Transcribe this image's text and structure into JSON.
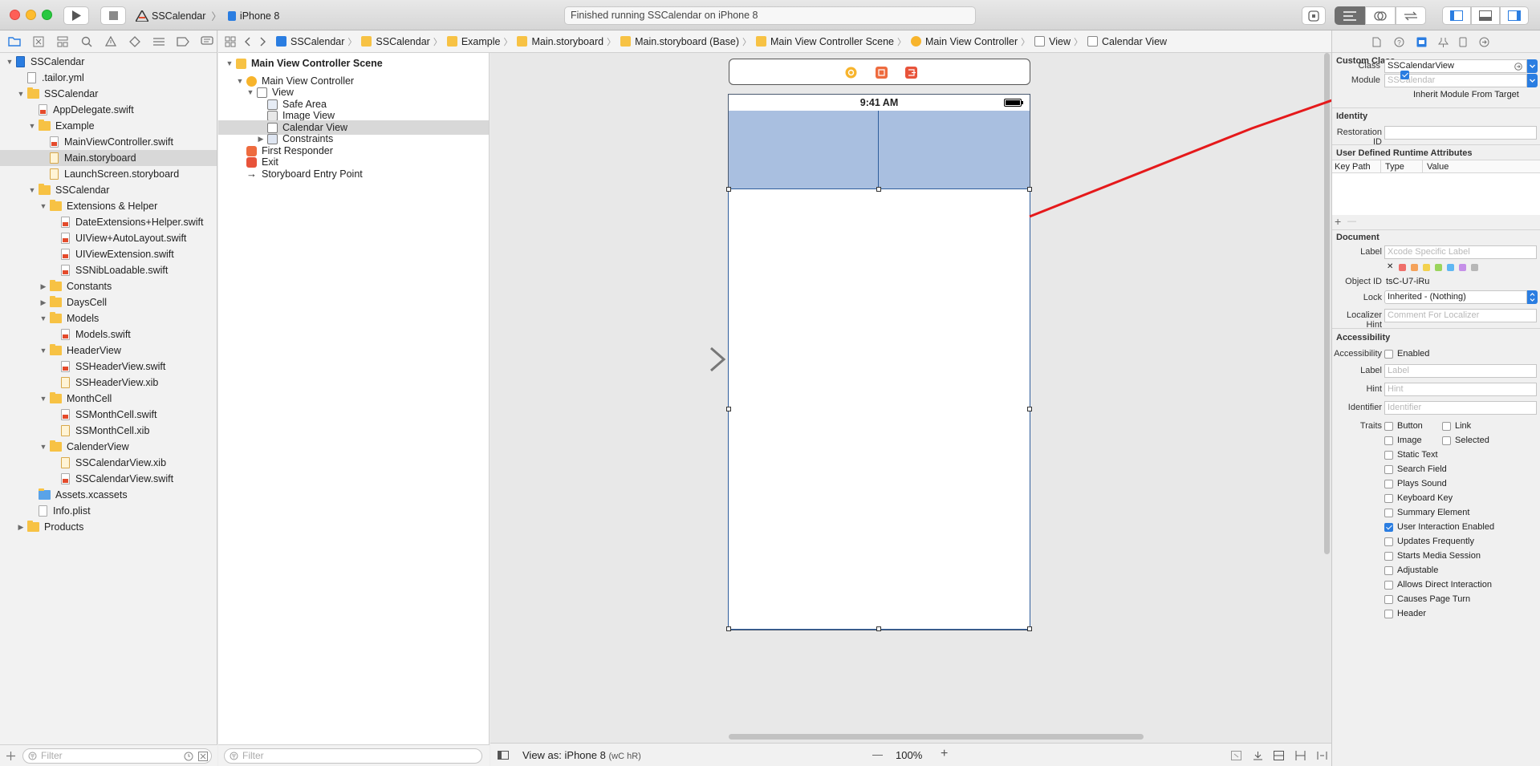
{
  "toolbar": {
    "scheme_name": "SSCalendar",
    "device_name": "iPhone 8",
    "activity_status": "Finished running SSCalendar on iPhone 8"
  },
  "navigator": {
    "items": [
      {
        "label": "SSCalendar",
        "indent": 0,
        "kind": "project",
        "open": true
      },
      {
        "label": ".tailor.yml",
        "indent": 1,
        "kind": "yml"
      },
      {
        "label": "SSCalendar",
        "indent": 1,
        "kind": "folder",
        "open": true
      },
      {
        "label": "AppDelegate.swift",
        "indent": 2,
        "kind": "swift"
      },
      {
        "label": "Example",
        "indent": 2,
        "kind": "folder",
        "open": true
      },
      {
        "label": "MainViewController.swift",
        "indent": 3,
        "kind": "swift"
      },
      {
        "label": "Main.storyboard",
        "indent": 3,
        "kind": "sb",
        "selected": true
      },
      {
        "label": "LaunchScreen.storyboard",
        "indent": 3,
        "kind": "sb"
      },
      {
        "label": "SSCalendar",
        "indent": 2,
        "kind": "folder",
        "open": true
      },
      {
        "label": "Extensions & Helper",
        "indent": 3,
        "kind": "folder",
        "open": true
      },
      {
        "label": "DateExtensions+Helper.swift",
        "indent": 4,
        "kind": "swift"
      },
      {
        "label": "UIView+AutoLayout.swift",
        "indent": 4,
        "kind": "swift"
      },
      {
        "label": "UIViewExtension.swift",
        "indent": 4,
        "kind": "swift"
      },
      {
        "label": "SSNibLoadable.swift",
        "indent": 4,
        "kind": "swift"
      },
      {
        "label": "Constants",
        "indent": 3,
        "kind": "folder",
        "open": false
      },
      {
        "label": "DaysCell",
        "indent": 3,
        "kind": "folder",
        "open": false
      },
      {
        "label": "Models",
        "indent": 3,
        "kind": "folder",
        "open": true
      },
      {
        "label": "Models.swift",
        "indent": 4,
        "kind": "swift"
      },
      {
        "label": "HeaderView",
        "indent": 3,
        "kind": "folder",
        "open": true
      },
      {
        "label": "SSHeaderView.swift",
        "indent": 4,
        "kind": "swift"
      },
      {
        "label": "SSHeaderView.xib",
        "indent": 4,
        "kind": "xib"
      },
      {
        "label": "MonthCell",
        "indent": 3,
        "kind": "folder",
        "open": true
      },
      {
        "label": "SSMonthCell.swift",
        "indent": 4,
        "kind": "swift"
      },
      {
        "label": "SSMonthCell.xib",
        "indent": 4,
        "kind": "xib"
      },
      {
        "label": "CalenderView",
        "indent": 3,
        "kind": "folder",
        "open": true
      },
      {
        "label": "SSCalendarView.xib",
        "indent": 4,
        "kind": "xib"
      },
      {
        "label": "SSCalendarView.swift",
        "indent": 4,
        "kind": "swift"
      },
      {
        "label": "Assets.xcassets",
        "indent": 2,
        "kind": "assets"
      },
      {
        "label": "Info.plist",
        "indent": 2,
        "kind": "plist"
      },
      {
        "label": "Products",
        "indent": 1,
        "kind": "folder",
        "open": false
      }
    ],
    "filter_placeholder": "Filter"
  },
  "jumpbar": {
    "crumbs": [
      "SSCalendar",
      "SSCalendar",
      "Example",
      "Main.storyboard",
      "Main.storyboard (Base)",
      "Main View Controller Scene",
      "Main View Controller",
      "View",
      "Calendar View"
    ]
  },
  "outline": {
    "scene_title": "Main View Controller Scene",
    "items": [
      {
        "label": "Main View Controller",
        "indent": 1,
        "icon": "vc"
      },
      {
        "label": "View",
        "indent": 2,
        "icon": "view"
      },
      {
        "label": "Safe Area",
        "indent": 3,
        "icon": "safe"
      },
      {
        "label": "Image View",
        "indent": 3,
        "icon": "image"
      },
      {
        "label": "Calendar View",
        "indent": 3,
        "icon": "view",
        "selected": true
      },
      {
        "label": "Constraints",
        "indent": 3,
        "icon": "constraints"
      },
      {
        "label": "First Responder",
        "indent": 1,
        "icon": "responder"
      },
      {
        "label": "Exit",
        "indent": 1,
        "icon": "exit"
      },
      {
        "label": "Storyboard Entry Point",
        "indent": 1,
        "icon": "arrow"
      }
    ],
    "filter_placeholder": "Filter"
  },
  "canvas": {
    "status_time": "9:41 AM",
    "view_as": "View as: iPhone 8",
    "view_as_traits": "(wC hR)",
    "zoom": "100%",
    "zoom_out": "—",
    "zoom_in": "+"
  },
  "inspector": {
    "custom_class": {
      "title": "Custom Class",
      "class_label": "Class",
      "class_value": "SSCalendarView",
      "module_label": "Module",
      "module_placeholder": "SSCalendar",
      "inherit_label": "Inherit Module From Target"
    },
    "identity": {
      "title": "Identity",
      "restoration_label": "Restoration ID"
    },
    "runtime_attributes": {
      "title": "User Defined Runtime Attributes",
      "columns": [
        "Key Path",
        "Type",
        "Value"
      ],
      "add": "+",
      "remove": "—"
    },
    "document": {
      "title": "Document",
      "label_label": "Label",
      "label_placeholder": "Xcode Specific Label",
      "clear_mark": "✕",
      "object_id_label": "Object ID",
      "object_id_value": "tsC-U7-iRu",
      "lock_label": "Lock",
      "lock_value": "Inherited - (Nothing)",
      "localizer_label": "Localizer Hint",
      "localizer_placeholder": "Comment For Localizer",
      "label_colors": [
        "#ef6f6a",
        "#f5a25a",
        "#f3d14e",
        "#9ad45c",
        "#5fb7f3",
        "#c58fe8",
        "#b7b7b7"
      ]
    },
    "accessibility": {
      "title": "Accessibility",
      "accessibility_label": "Accessibility",
      "enabled_label": "Enabled",
      "label_label": "Label",
      "label_placeholder": "Label",
      "hint_label": "Hint",
      "hint_placeholder": "Hint",
      "identifier_label": "Identifier",
      "identifier_placeholder": "Identifier",
      "traits_label": "Traits",
      "traits": [
        {
          "label": "Button",
          "checked": false
        },
        {
          "label": "Link",
          "checked": false
        },
        {
          "label": "Image",
          "checked": false
        },
        {
          "label": "Selected",
          "checked": false
        },
        {
          "label": "Static Text",
          "checked": false
        },
        {
          "label": "Search Field",
          "checked": false
        },
        {
          "label": "Plays Sound",
          "checked": false
        },
        {
          "label": "Keyboard Key",
          "checked": false
        },
        {
          "label": "Summary Element",
          "checked": false
        },
        {
          "label": "User Interaction Enabled",
          "checked": true
        },
        {
          "label": "Updates Frequently",
          "checked": false
        },
        {
          "label": "Starts Media Session",
          "checked": false
        },
        {
          "label": "Adjustable",
          "checked": false
        },
        {
          "label": "Allows Direct Interaction",
          "checked": false
        },
        {
          "label": "Causes Page Turn",
          "checked": false
        },
        {
          "label": "Header",
          "checked": false
        }
      ]
    }
  },
  "colors": {
    "accent": "#2a7de1",
    "selection_fill": "#a9bfe0",
    "annotation_arrow": "#e5191b",
    "folder": "#f7c244"
  }
}
